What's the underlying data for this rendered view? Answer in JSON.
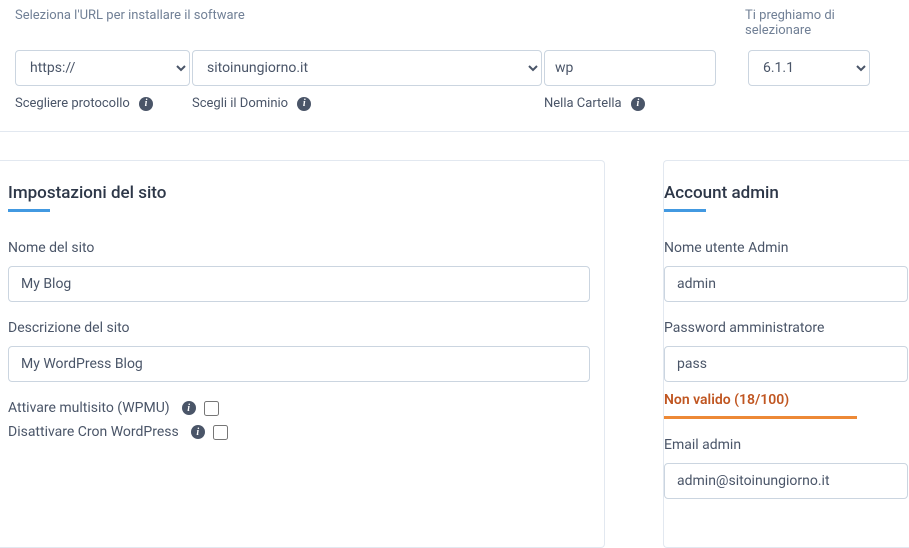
{
  "top": {
    "select_url_label": "Seleziona l'URL per installare il software",
    "select_version_label": "Ti preghiamo di selezionare",
    "protocol": "https://",
    "domain": "sitoinungiorno.it",
    "folder": "wp",
    "version": "6.1.1",
    "helper_protocol": "Scegliere protocollo",
    "helper_domain": "Scegli il Dominio",
    "helper_folder": "Nella Cartella"
  },
  "site_settings": {
    "title": "Impostazioni del sito",
    "site_name_label": "Nome del sito",
    "site_name_value": "My Blog",
    "site_desc_label": "Descrizione del sito",
    "site_desc_value": "My WordPress Blog",
    "multisite_label": "Attivare multisito (WPMU)",
    "cron_label": "Disattivare Cron WordPress"
  },
  "admin": {
    "title": "Account admin",
    "username_label": "Nome utente Admin",
    "username_value": "admin",
    "password_label": "Password amministratore",
    "password_value": "pass",
    "invalid_text": "Non valido (18/100)",
    "email_label": "Email admin",
    "email_value": "admin@sitoinungiorno.it"
  }
}
